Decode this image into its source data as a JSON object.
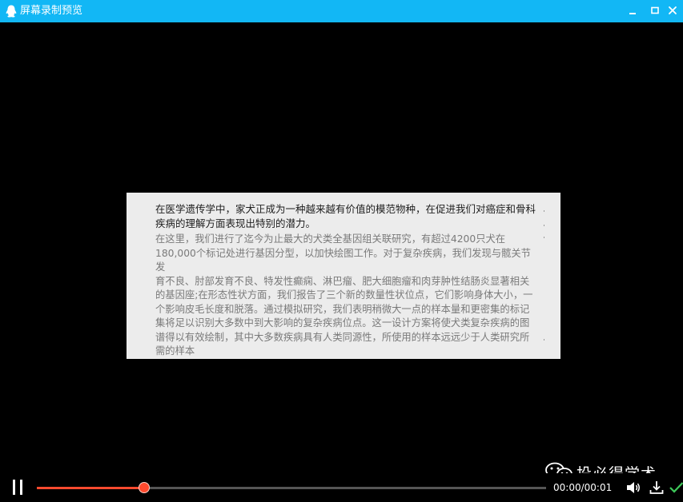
{
  "window": {
    "title": "屏幕录制预览",
    "icons": {
      "app": "qq-penguin-icon",
      "minimize": "minimize-icon",
      "maximize": "maximize-icon",
      "close": "close-icon"
    },
    "accent": "#12b7f5"
  },
  "slide": {
    "headline_lines": [
      "在医学遗传学中，家犬正成为一种越来越有价值的模范物种，在促进我们对癌症和骨科",
      "疾病的理解方面表现出特别的潜力。"
    ],
    "paragraph_lines": [
      "在这里，我们进行了迄今为止最大的犬类全基因组关联研究，有超过4200只犬在",
      "180,000个标记处进行基因分型，以加快绘图工作。对于复杂疾病，我们发现与髋关节发",
      "育不良、肘部发育不良、特发性癫痫、淋巴瘤、肥大细胞瘤和肉芽肿性结肠炎显著相关",
      "的基因座;在形态性状方面，我们报告了三个新的数量性状位点，它们影响身体大小，一",
      "个影响皮毛长度和脱落。通过模拟研究，我们表明稍微大一点的样本量和更密集的标记",
      "集将足以识别大多数中到大影响的复杂疾病位点。这一设计方案将使犬类复杂疾病的图",
      "谱得以有效绘制，其中大多数疾病具有人类同源性，所使用的样本远远少于人类研究所",
      "需的样本"
    ]
  },
  "watermark": {
    "text": "投必得学术",
    "icon": "wechat-icon"
  },
  "player": {
    "current_time": "00:00",
    "separator": "/",
    "total_time": "00:01",
    "progress": 0.21,
    "progress_color": "#ff4a2e",
    "icons": {
      "pause": "pause-icon",
      "volume": "volume-icon",
      "download": "download-icon",
      "confirm": "checkmark-icon"
    }
  }
}
